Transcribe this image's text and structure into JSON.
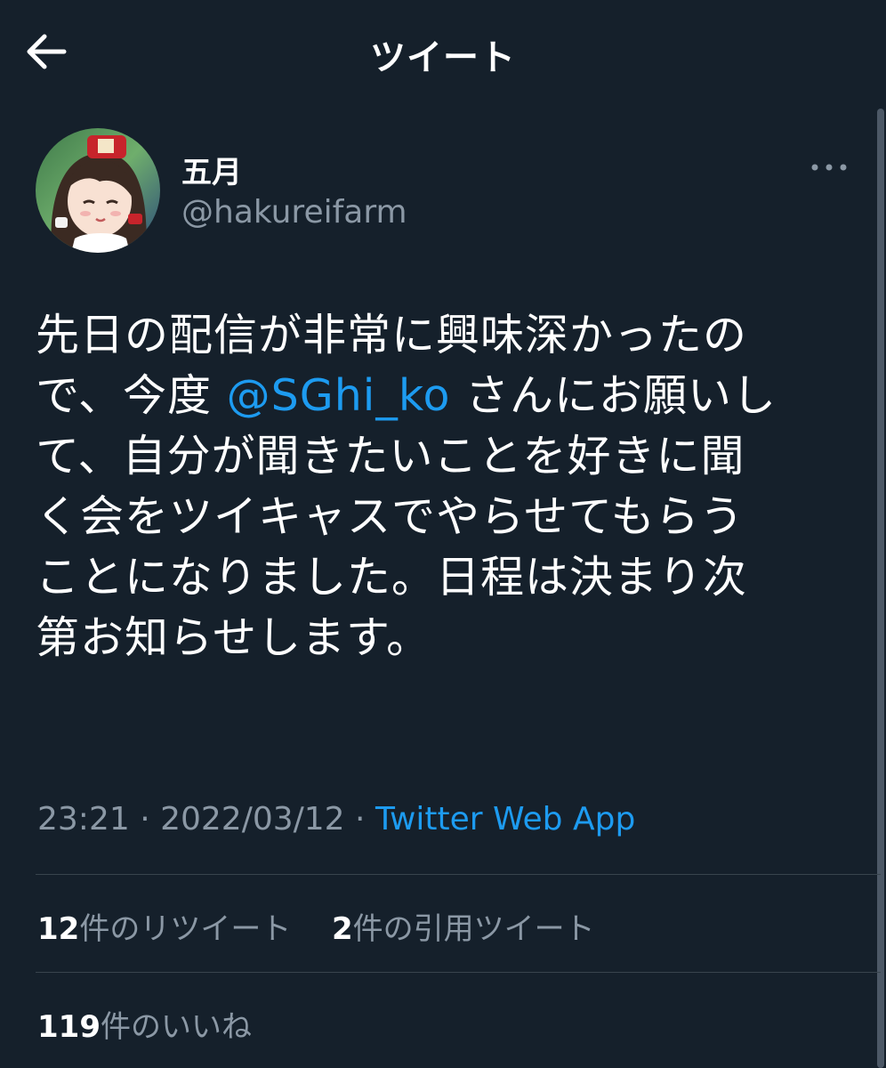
{
  "header": {
    "title": "ツイート",
    "back_icon": "arrow-left-icon"
  },
  "author": {
    "display_name": "五月",
    "handle": "@hakureifarm",
    "avatar_icon": "anime-character-avatar"
  },
  "tweet": {
    "lines": [
      {
        "before": "先日の配信が非常に興味深かったの",
        "mention": "",
        "after": ""
      },
      {
        "before": "で、今度 ",
        "mention": "@SGhi_ko",
        "after": " さんにお願いし"
      },
      {
        "before": "て、自分が聞きたいことを好きに聞",
        "mention": "",
        "after": ""
      },
      {
        "before": "く会をツイキャスでやらせてもらう",
        "mention": "",
        "after": ""
      },
      {
        "before": "ことになりました。日程は決まり次",
        "mention": "",
        "after": ""
      },
      {
        "before": "第お知らせします。",
        "mention": "",
        "after": ""
      }
    ]
  },
  "meta": {
    "time": "23:21",
    "sep1": " · ",
    "date": "2022/03/12",
    "sep2": " · ",
    "source": "Twitter Web App"
  },
  "stats": {
    "retweets_count": "12",
    "retweets_label": "件のリツイート",
    "quotes_count": "2",
    "quotes_label": "件の引用ツイート",
    "likes_count": "119",
    "likes_label": "件のいいね"
  },
  "colors": {
    "background": "#15202b",
    "accent": "#1d9bf0",
    "secondary_text": "#8b98a5",
    "divider": "#38444d"
  }
}
